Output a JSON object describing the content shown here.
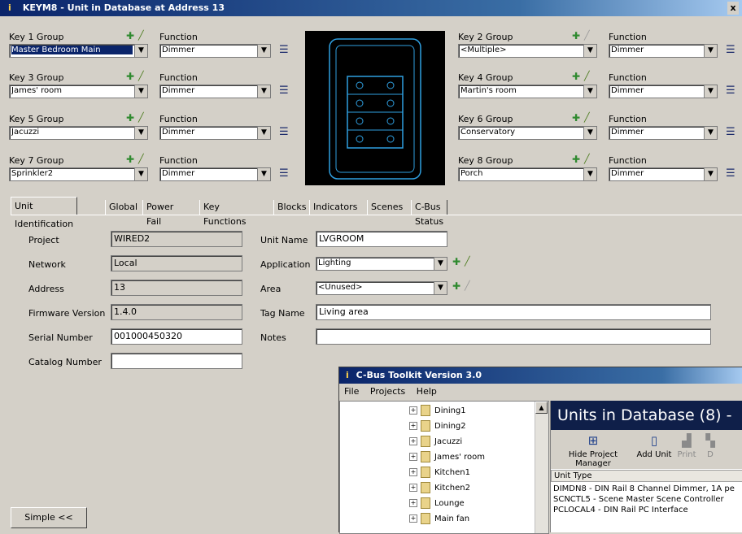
{
  "window": {
    "title": "KEYM8 - Unit in Database at Address 13",
    "close": "x"
  },
  "keys": [
    {
      "group_label": "Key 1 Group",
      "group": "Master Bedroom Main",
      "function_label": "Function",
      "function": "Dimmer"
    },
    {
      "group_label": "Key 2 Group",
      "group": "<Multiple>",
      "function_label": "Function",
      "function": "Dimmer"
    },
    {
      "group_label": "Key 3 Group",
      "group": "James' room",
      "function_label": "Function",
      "function": "Dimmer"
    },
    {
      "group_label": "Key 4 Group",
      "group": "Martin's room",
      "function_label": "Function",
      "function": "Dimmer"
    },
    {
      "group_label": "Key 5 Group",
      "group": "Jacuzzi",
      "function_label": "Function",
      "function": "Dimmer"
    },
    {
      "group_label": "Key 6 Group",
      "group": "Conservatory",
      "function_label": "Function",
      "function": "Dimmer"
    },
    {
      "group_label": "Key 7 Group",
      "group": "Sprinkler2",
      "function_label": "Function",
      "function": "Dimmer"
    },
    {
      "group_label": "Key 8 Group",
      "group": "Porch",
      "function_label": "Function",
      "function": "Dimmer"
    }
  ],
  "tabs": [
    "Unit Identification",
    "Global",
    "Power Fail",
    "Key Functions",
    "Blocks",
    "Indicators",
    "Scenes",
    "C-Bus Status"
  ],
  "unit": {
    "project_label": "Project",
    "project": "WIRED2",
    "network_label": "Network",
    "network": "Local",
    "address_label": "Address",
    "address": "13",
    "firmware_label": "Firmware Version",
    "firmware": "1.4.0",
    "serial_label": "Serial Number",
    "serial": "001000450320",
    "catalog_label": "Catalog Number",
    "catalog": "",
    "unit_name_label": "Unit Name",
    "unit_name": "LVGROOM",
    "application_label": "Application",
    "application": "Lighting",
    "area_label": "Area",
    "area": "<Unused>",
    "tag_name_label": "Tag Name",
    "tag_name": "Living area",
    "notes_label": "Notes",
    "notes": ""
  },
  "simple_button": "Simple <<",
  "toolkit": {
    "title": "C-Bus Toolkit Version 3.0",
    "menu": [
      "File",
      "Projects",
      "Help"
    ],
    "tree": [
      "Dining1",
      "Dining2",
      "Jacuzzi",
      "James' room",
      "Kitchen1",
      "Kitchen2",
      "Lounge",
      "Main fan"
    ],
    "units_header": "Units in Database (8) -",
    "toolbar": [
      "Hide Project Manager",
      "Add Unit",
      "Print",
      "D"
    ],
    "column": "Unit Type",
    "units": [
      "DIMDN8 - DIN Rail 8 Channel Dimmer, 1A pe",
      "SCNCTL5 - Scene Master Scene Controller",
      "PCLOCAL4 - DIN Rail PC Interface"
    ]
  },
  "colors": {
    "title_bar": "#0a246a",
    "keypad_outline": "#2f9fe0",
    "plus_icon": "#2f8a2f"
  }
}
